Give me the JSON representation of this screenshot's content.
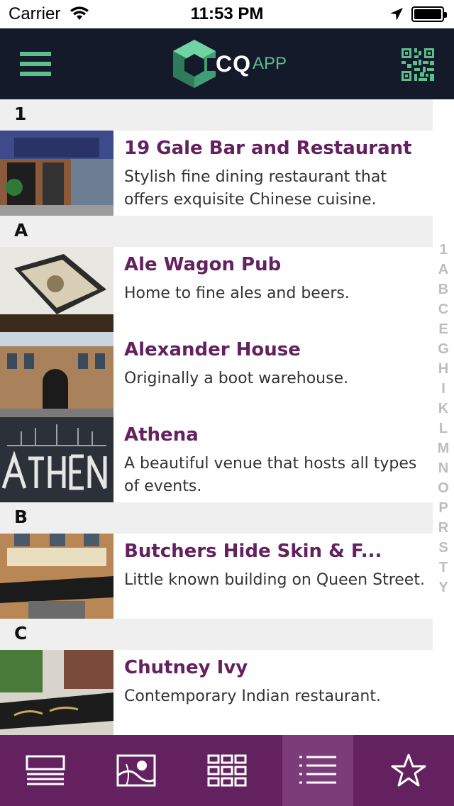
{
  "status_bar": {
    "carrier": "Carrier",
    "time": "11:53 PM"
  },
  "navbar": {
    "logo_cq": "CQ",
    "logo_app": "APP",
    "accent_color": "#5bbf8c",
    "background_color": "#151a2b"
  },
  "list": {
    "sections": [
      {
        "header": "1",
        "items": [
          {
            "title": "19 Gale Bar and Restaurant",
            "description": "Stylish fine dining restaurant that offers exquisite Chinese cuisine."
          }
        ]
      },
      {
        "header": "A",
        "items": [
          {
            "title": "Ale Wagon Pub",
            "description": "Home to fine ales and beers."
          },
          {
            "title": "Alexander House",
            "description": "Originally a boot warehouse."
          },
          {
            "title": "Athena",
            "description": "A beautiful venue that hosts all types of events."
          }
        ]
      },
      {
        "header": "B",
        "items": [
          {
            "title": "Butchers Hide Skin & F...",
            "description": "Little known building on Queen Street."
          }
        ]
      },
      {
        "header": "C",
        "items": [
          {
            "title": "Chutney Ivy",
            "description": "Contemporary Indian restaurant."
          }
        ]
      }
    ],
    "title_color": "#63215f"
  },
  "index_letters": [
    "1",
    "A",
    "B",
    "C",
    "E",
    "G",
    "H",
    "I",
    "K",
    "L",
    "M",
    "N",
    "O",
    "P",
    "R",
    "S",
    "T",
    "Y"
  ],
  "tab_bar": {
    "tabs": [
      {
        "icon": "news-icon"
      },
      {
        "icon": "map-icon"
      },
      {
        "icon": "grid-icon"
      },
      {
        "icon": "list-icon",
        "active": true
      },
      {
        "icon": "star-icon"
      }
    ],
    "background_color": "#63215f"
  }
}
